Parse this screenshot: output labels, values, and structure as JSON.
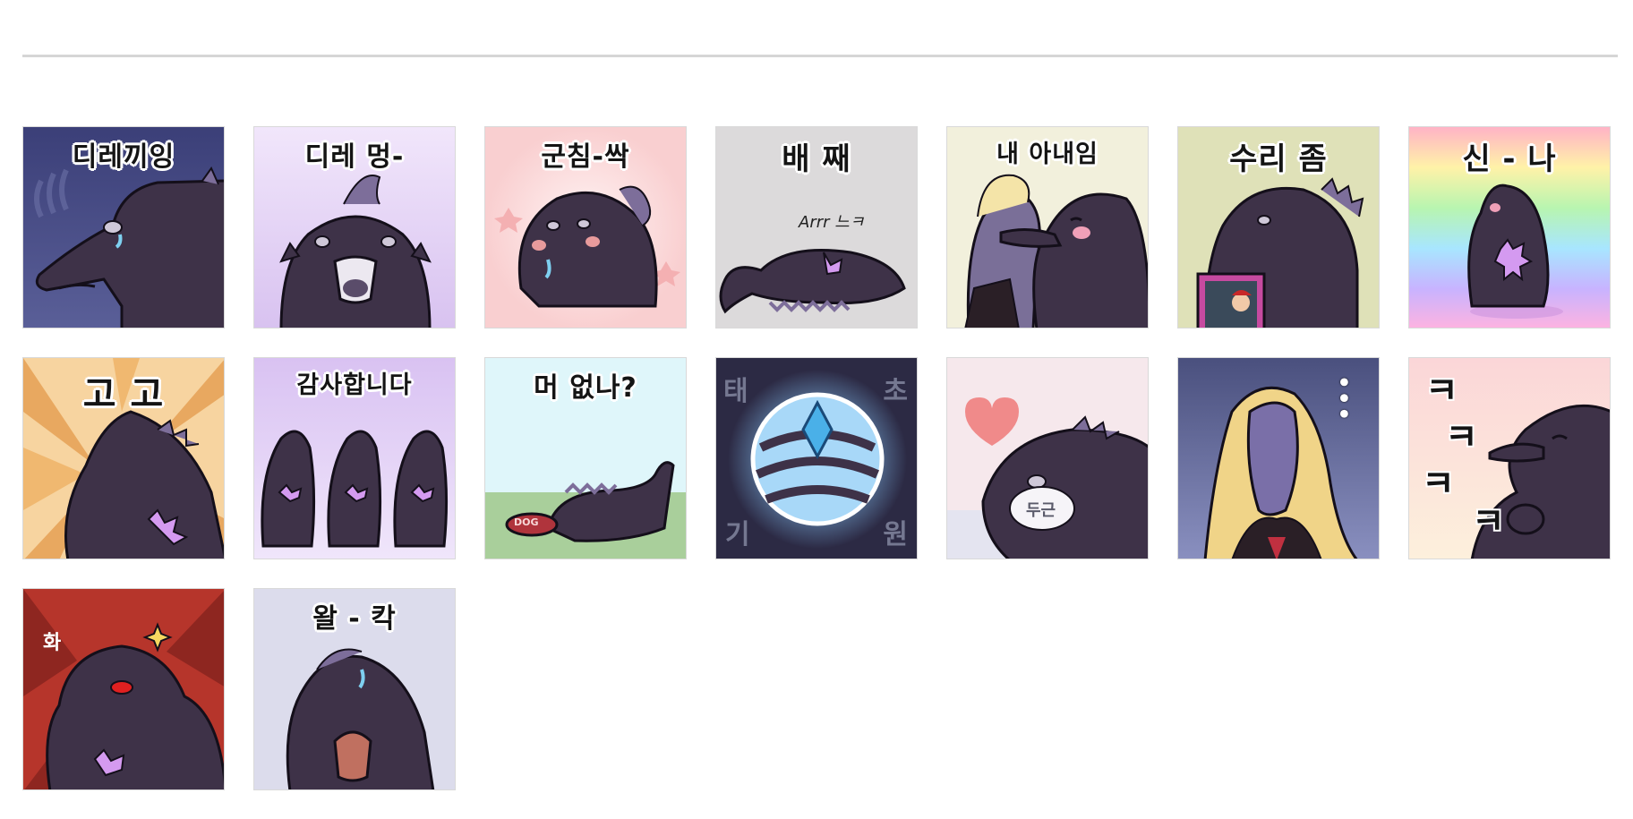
{
  "stickers": [
    {
      "caption": "디레끼잉",
      "bg": "#4a4f86"
    },
    {
      "caption": "디레 멍-",
      "bg": "#e7d6f6"
    },
    {
      "caption": "군침-싹",
      "bg": "#fde6e6"
    },
    {
      "caption": "배 째",
      "note": "Arrr 느ㅋ",
      "bg": "#dcdada"
    },
    {
      "caption": "내 아내임",
      "bg": "#f2f0dc"
    },
    {
      "caption": "수리 좀",
      "bg": "#dfe1b8"
    },
    {
      "caption": "신 - 나",
      "bg": "rainbow"
    },
    {
      "caption": "고  고",
      "bg": "#f7c48a"
    },
    {
      "caption": "감사합니다",
      "bg": "#e4d3f4"
    },
    {
      "caption": "머 없나?",
      "bowl": "DOG",
      "bg": "#dff6fa"
    },
    {
      "corners": [
        "태",
        "초",
        "기",
        "원"
      ],
      "bg": "#2c2a44"
    },
    {
      "bubble": "두근",
      "bg": "#f6e8ec"
    },
    {
      "dots": "•••",
      "bg": "#5a6494"
    },
    {
      "side": [
        "ㅋ",
        "ㅋ",
        "ㅋ",
        "ㅋ"
      ],
      "bg": "#fde7e6"
    },
    {
      "mark": "화",
      "bg": "#b6352b"
    },
    {
      "caption": "왈 - 칵",
      "bg": "#dcdcec"
    }
  ]
}
